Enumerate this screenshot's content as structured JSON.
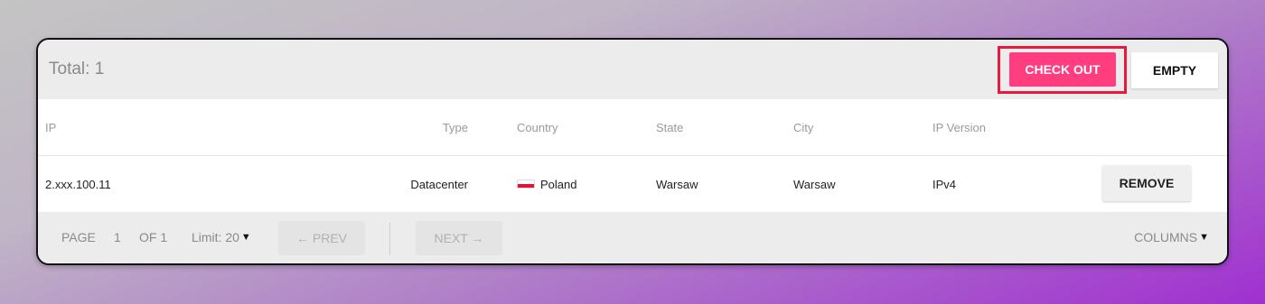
{
  "header": {
    "total_label": "Total: 1",
    "checkout_label": "CHECK OUT",
    "empty_label": "EMPTY"
  },
  "table": {
    "columns": [
      "IP",
      "Type",
      "Country",
      "State",
      "City",
      "IP Version"
    ],
    "rows": [
      {
        "ip": "2.xxx.100.11",
        "type": "Datacenter",
        "country": "Poland",
        "country_flag": "poland-flag-icon",
        "state": "Warsaw",
        "city": "Warsaw",
        "ip_version": "IPv4",
        "action_label": "REMOVE"
      }
    ]
  },
  "footer": {
    "page_label": "PAGE",
    "page_number": "1",
    "of_label": "OF 1",
    "limit_label": "Limit: 20",
    "prev_label": "← PREV",
    "next_label": "NEXT →",
    "columns_label": "COLUMNS"
  },
  "colors": {
    "checkout_button": "#ff3d7f",
    "highlight_border": "#e8193c",
    "background_start": "#c4c4c4",
    "background_end": "#a030d0"
  },
  "icons": {
    "limit_dropdown": "caret-down-icon",
    "columns_dropdown": "caret-down-icon"
  }
}
